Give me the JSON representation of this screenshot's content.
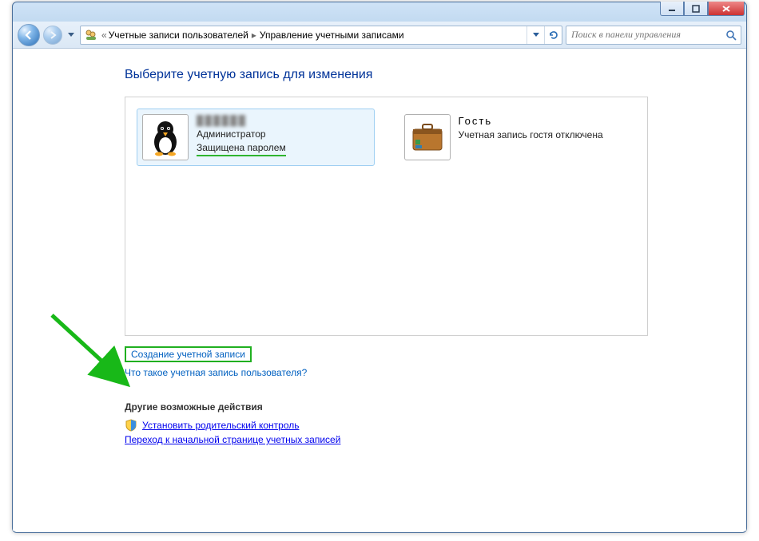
{
  "breadcrumb": {
    "level1": "Учетные записи пользователей",
    "level2": "Управление учетными записами"
  },
  "search": {
    "placeholder": "Поиск в панели управления"
  },
  "page": {
    "title": "Выберите учетную запись для изменения"
  },
  "accounts": [
    {
      "name_hidden": "██████",
      "role": "Администратор",
      "password_status": "Защищена паролем",
      "selected": true
    },
    {
      "name": "Гость",
      "status": "Учетная запись гостя отключена",
      "selected": false
    }
  ],
  "links": {
    "create_account": "Создание учетной записи",
    "what_is_account": "Что такое учетная запись пользователя?"
  },
  "other": {
    "heading": "Другие возможные действия",
    "parental": "Установить родительский контроль",
    "goto_home": "Переход к начальной странице учетных записей"
  }
}
